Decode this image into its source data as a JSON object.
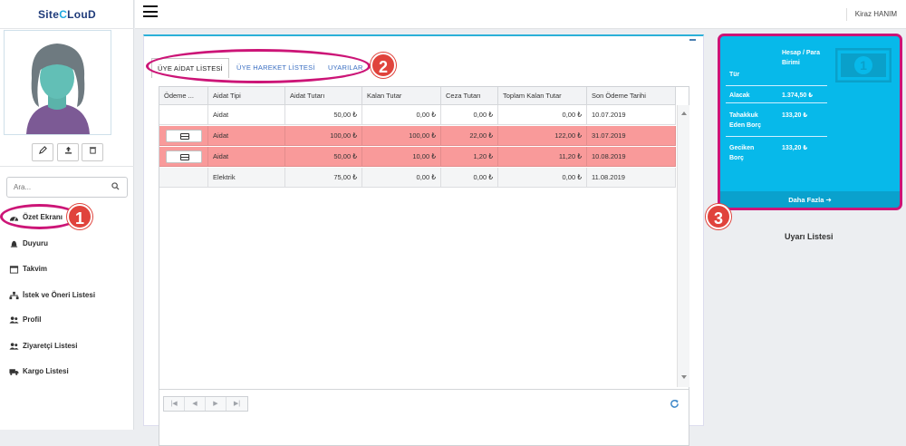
{
  "app": {
    "brand_prefix": "Site",
    "brand_c": "C",
    "brand_suffix": "LouD"
  },
  "topbar": {
    "user": "Kiraz HANIM"
  },
  "profile": {
    "buttons": [
      {
        "icon": "edit-icon"
      },
      {
        "icon": "upload-icon"
      },
      {
        "icon": "trash-icon"
      }
    ]
  },
  "search": {
    "placeholder": "Ara..."
  },
  "nav": [
    {
      "label": "Özet Ekranı",
      "icon": "dashboard-icon"
    },
    {
      "label": "Duyuru",
      "icon": "bell-icon"
    },
    {
      "label": "Takvim",
      "icon": "calendar-icon"
    },
    {
      "label": "İstek ve Öneri Listesi",
      "icon": "sitemap-icon"
    },
    {
      "label": "Profil",
      "icon": "users-icon"
    },
    {
      "label": "Ziyaretçi Listesi",
      "icon": "users-icon"
    },
    {
      "label": "Kargo Listesi",
      "icon": "truck-icon"
    }
  ],
  "tabs": [
    "ÜYE AİDAT LİSTESİ",
    "ÜYE HAREKET LİSTESİ",
    "UYARILAR"
  ],
  "grid": {
    "headers": [
      "Ödeme ...",
      "Aidat Tipi",
      "Aidat Tutarı",
      "Kalan Tutar",
      "Ceza Tutarı",
      "Toplam Kalan Tutar",
      "Son Ödeme Tarihi"
    ],
    "rows": [
      {
        "pay": false,
        "highlight": false,
        "type": "Aidat",
        "amount": "50,00 ₺",
        "remaining": "0,00 ₺",
        "penalty": "0,00 ₺",
        "total": "0,00 ₺",
        "due": "10.07.2019"
      },
      {
        "pay": true,
        "highlight": true,
        "type": "Aidat",
        "amount": "100,00 ₺",
        "remaining": "100,00 ₺",
        "penalty": "22,00 ₺",
        "total": "122,00 ₺",
        "due": "31.07.2019"
      },
      {
        "pay": true,
        "highlight": true,
        "type": "Aidat",
        "amount": "50,00 ₺",
        "remaining": "10,00 ₺",
        "penalty": "1,20 ₺",
        "total": "11,20 ₺",
        "due": "10.08.2019"
      },
      {
        "pay": false,
        "highlight": false,
        "type": "Elektrik",
        "amount": "75,00 ₺",
        "remaining": "0,00 ₺",
        "penalty": "0,00 ₺",
        "total": "0,00 ₺",
        "due": "11.08.2019"
      }
    ],
    "pager": [
      "first-page-icon",
      "prev-page-icon",
      "next-page-icon",
      "last-page-icon"
    ]
  },
  "summary": {
    "head_left": "Tür",
    "head_right": "Hesap / Para Birimi",
    "rows": [
      {
        "label": "Alacak",
        "value": "1.374,50 ₺"
      },
      {
        "label": "Tahakkuk Eden Borç",
        "value": "133,20 ₺"
      },
      {
        "label": "Geciken Borç",
        "value": "133,20 ₺"
      }
    ],
    "more": "Daha Fazla"
  },
  "warnings_title": "Uyarı Listesi",
  "annotations": [
    "1",
    "2",
    "3"
  ],
  "colors": {
    "accent": "#07b9ea",
    "highlight_row": "#f99a9a",
    "annotation": "#cc1577",
    "badge": "#e0433c"
  }
}
